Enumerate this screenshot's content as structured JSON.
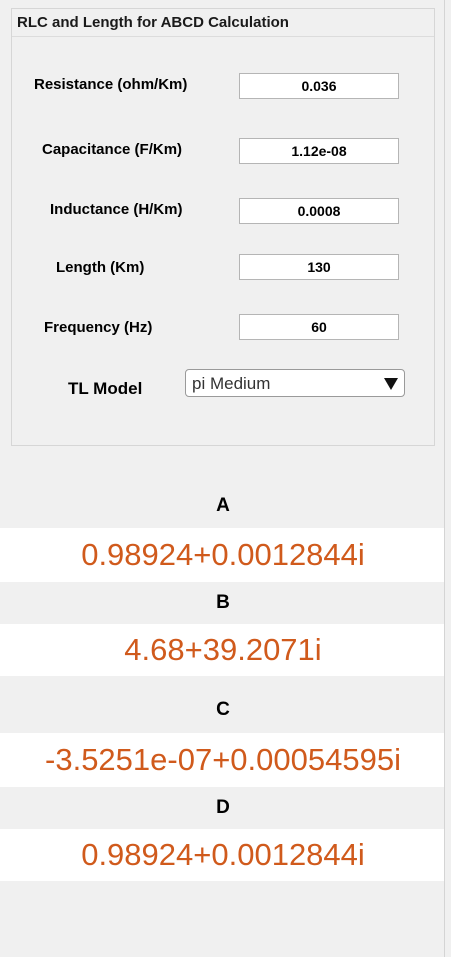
{
  "panel": {
    "title": "RLC and Length for ABCD Calculation"
  },
  "fields": {
    "resistance": {
      "label": "Resistance (ohm/Km)",
      "value": "0.036"
    },
    "capacitance": {
      "label": "Capacitance (F/Km)",
      "value": "1.12e-08"
    },
    "inductance": {
      "label": "Inductance (H/Km)",
      "value": "0.0008"
    },
    "length": {
      "label": "Length (Km)",
      "value": "130"
    },
    "frequency": {
      "label": "Frequency (Hz)",
      "value": "60"
    }
  },
  "model": {
    "label": "TL Model",
    "selected": "pi Medium",
    "arrow_icon": "triangle-down-icon"
  },
  "results": {
    "a": {
      "label": "A",
      "value": "0.98924+0.0012844i"
    },
    "b": {
      "label": "B",
      "value": "4.68+39.2071i"
    },
    "c": {
      "label": "C",
      "value": "-3.5251e-07+0.00054595i"
    },
    "d": {
      "label": "D",
      "value": "0.98924+0.0012844i"
    }
  },
  "colors": {
    "result_text": "#d05a1c",
    "background": "#f0f0f0",
    "result_background": "#ffffff"
  }
}
